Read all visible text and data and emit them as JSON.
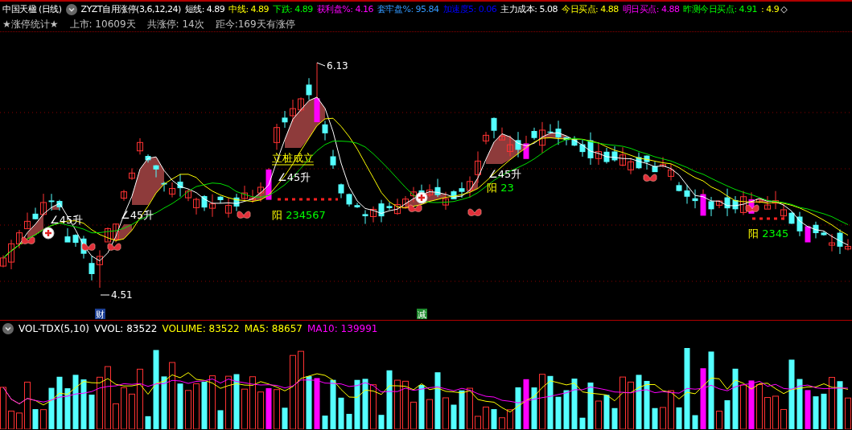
{
  "title_bar": {
    "security": "中国天楹 (日线)",
    "indicator": "ZYZT自用涨停(3,6,12,24)",
    "readings": [
      {
        "text": "短线: 4.89",
        "color": "#ffffff"
      },
      {
        "text": "中线: 4.89",
        "color": "#ffff00"
      },
      {
        "text": "下跌: 4.89",
        "color": "#00ff00"
      },
      {
        "text": "获利盘%: 4.16",
        "color": "#ff00ff"
      },
      {
        "text": "套牢盘%: 95.84",
        "color": "#3399ff"
      },
      {
        "text": "加速度5: 0.06",
        "color": "#0000ff"
      },
      {
        "text": "主力成本: 5.08",
        "color": "#ffffff"
      },
      {
        "text": "今日买点: 4.88",
        "color": "#ffff00"
      },
      {
        "text": "明日买点: 4.88",
        "color": "#ff00ff"
      },
      {
        "text": "昨测今日买点: 4.91",
        "color": "#00ff00"
      },
      {
        "text": ": 4.9",
        "color": "#ffff00"
      }
    ],
    "end_glyph": "◇"
  },
  "stats": [
    "★涨停统计★",
    "上市: 10609天",
    "共涨停: 14次",
    "距今:169天有涨停"
  ],
  "main_chart": {
    "price_high": "6.13",
    "price_low": "4.51",
    "angle_labels": [
      "∠45升",
      "∠45升",
      "∠45升",
      "∠45升"
    ],
    "signal_label": "立桩成立",
    "yang_counts": [
      {
        "prefix": "阳",
        "digits": "234567"
      },
      {
        "prefix": "阳",
        "digits": "23"
      },
      {
        "prefix": "阳",
        "digits": "2345"
      }
    ],
    "event_marks": [
      {
        "text": "财",
        "color": "#1c3f94"
      },
      {
        "text": "减",
        "color": "#1f8a2e"
      }
    ]
  },
  "volume_panel": {
    "indicator": "VOL-TDX(5,10)",
    "readings": [
      {
        "text": "VVOL: 83522",
        "color": "#ffffff"
      },
      {
        "text": "VOLUME: 83522",
        "color": "#ffff00"
      },
      {
        "text": "MA5: 88657",
        "color": "#ffff00"
      },
      {
        "text": "MA10: 139991",
        "color": "#ff00ff"
      }
    ]
  }
}
